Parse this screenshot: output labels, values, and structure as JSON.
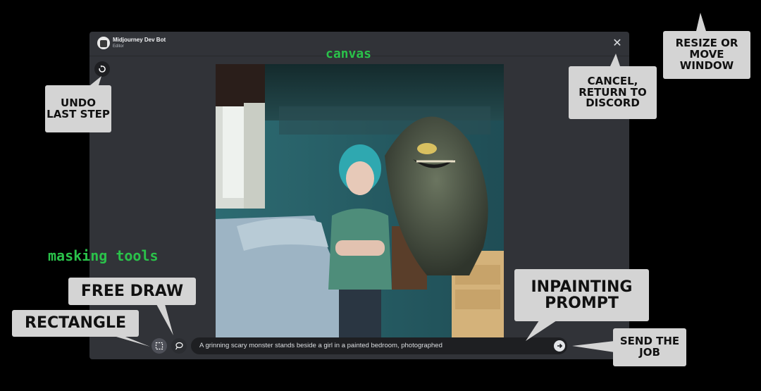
{
  "window": {
    "bot_name": "Midjourney Dev Bot",
    "bot_subtitle": "Editor"
  },
  "canvas_label": "canvas",
  "masking_tools_label": "masking tools",
  "prompt": {
    "value": "A grinning scary monster stands beside a girl in a painted bedroom, photographed"
  },
  "callouts": {
    "undo": "Undo last step",
    "cancel": "Cancel, return to Discord",
    "resize": "Resize or move window",
    "free_draw": "Free draw",
    "rectangle": "Rectangle",
    "inpainting": "Inpainting prompt",
    "send": "Send the job"
  },
  "icons": {
    "close": "close-icon",
    "undo": "undo-icon",
    "rectangle": "rectangle-select-icon",
    "free_draw": "lasso-icon",
    "send": "send-arrow-icon"
  },
  "colors": {
    "window_bg": "#313338",
    "annotation_green": "#2ac24a",
    "callout_bg": "#d4d4d4"
  }
}
